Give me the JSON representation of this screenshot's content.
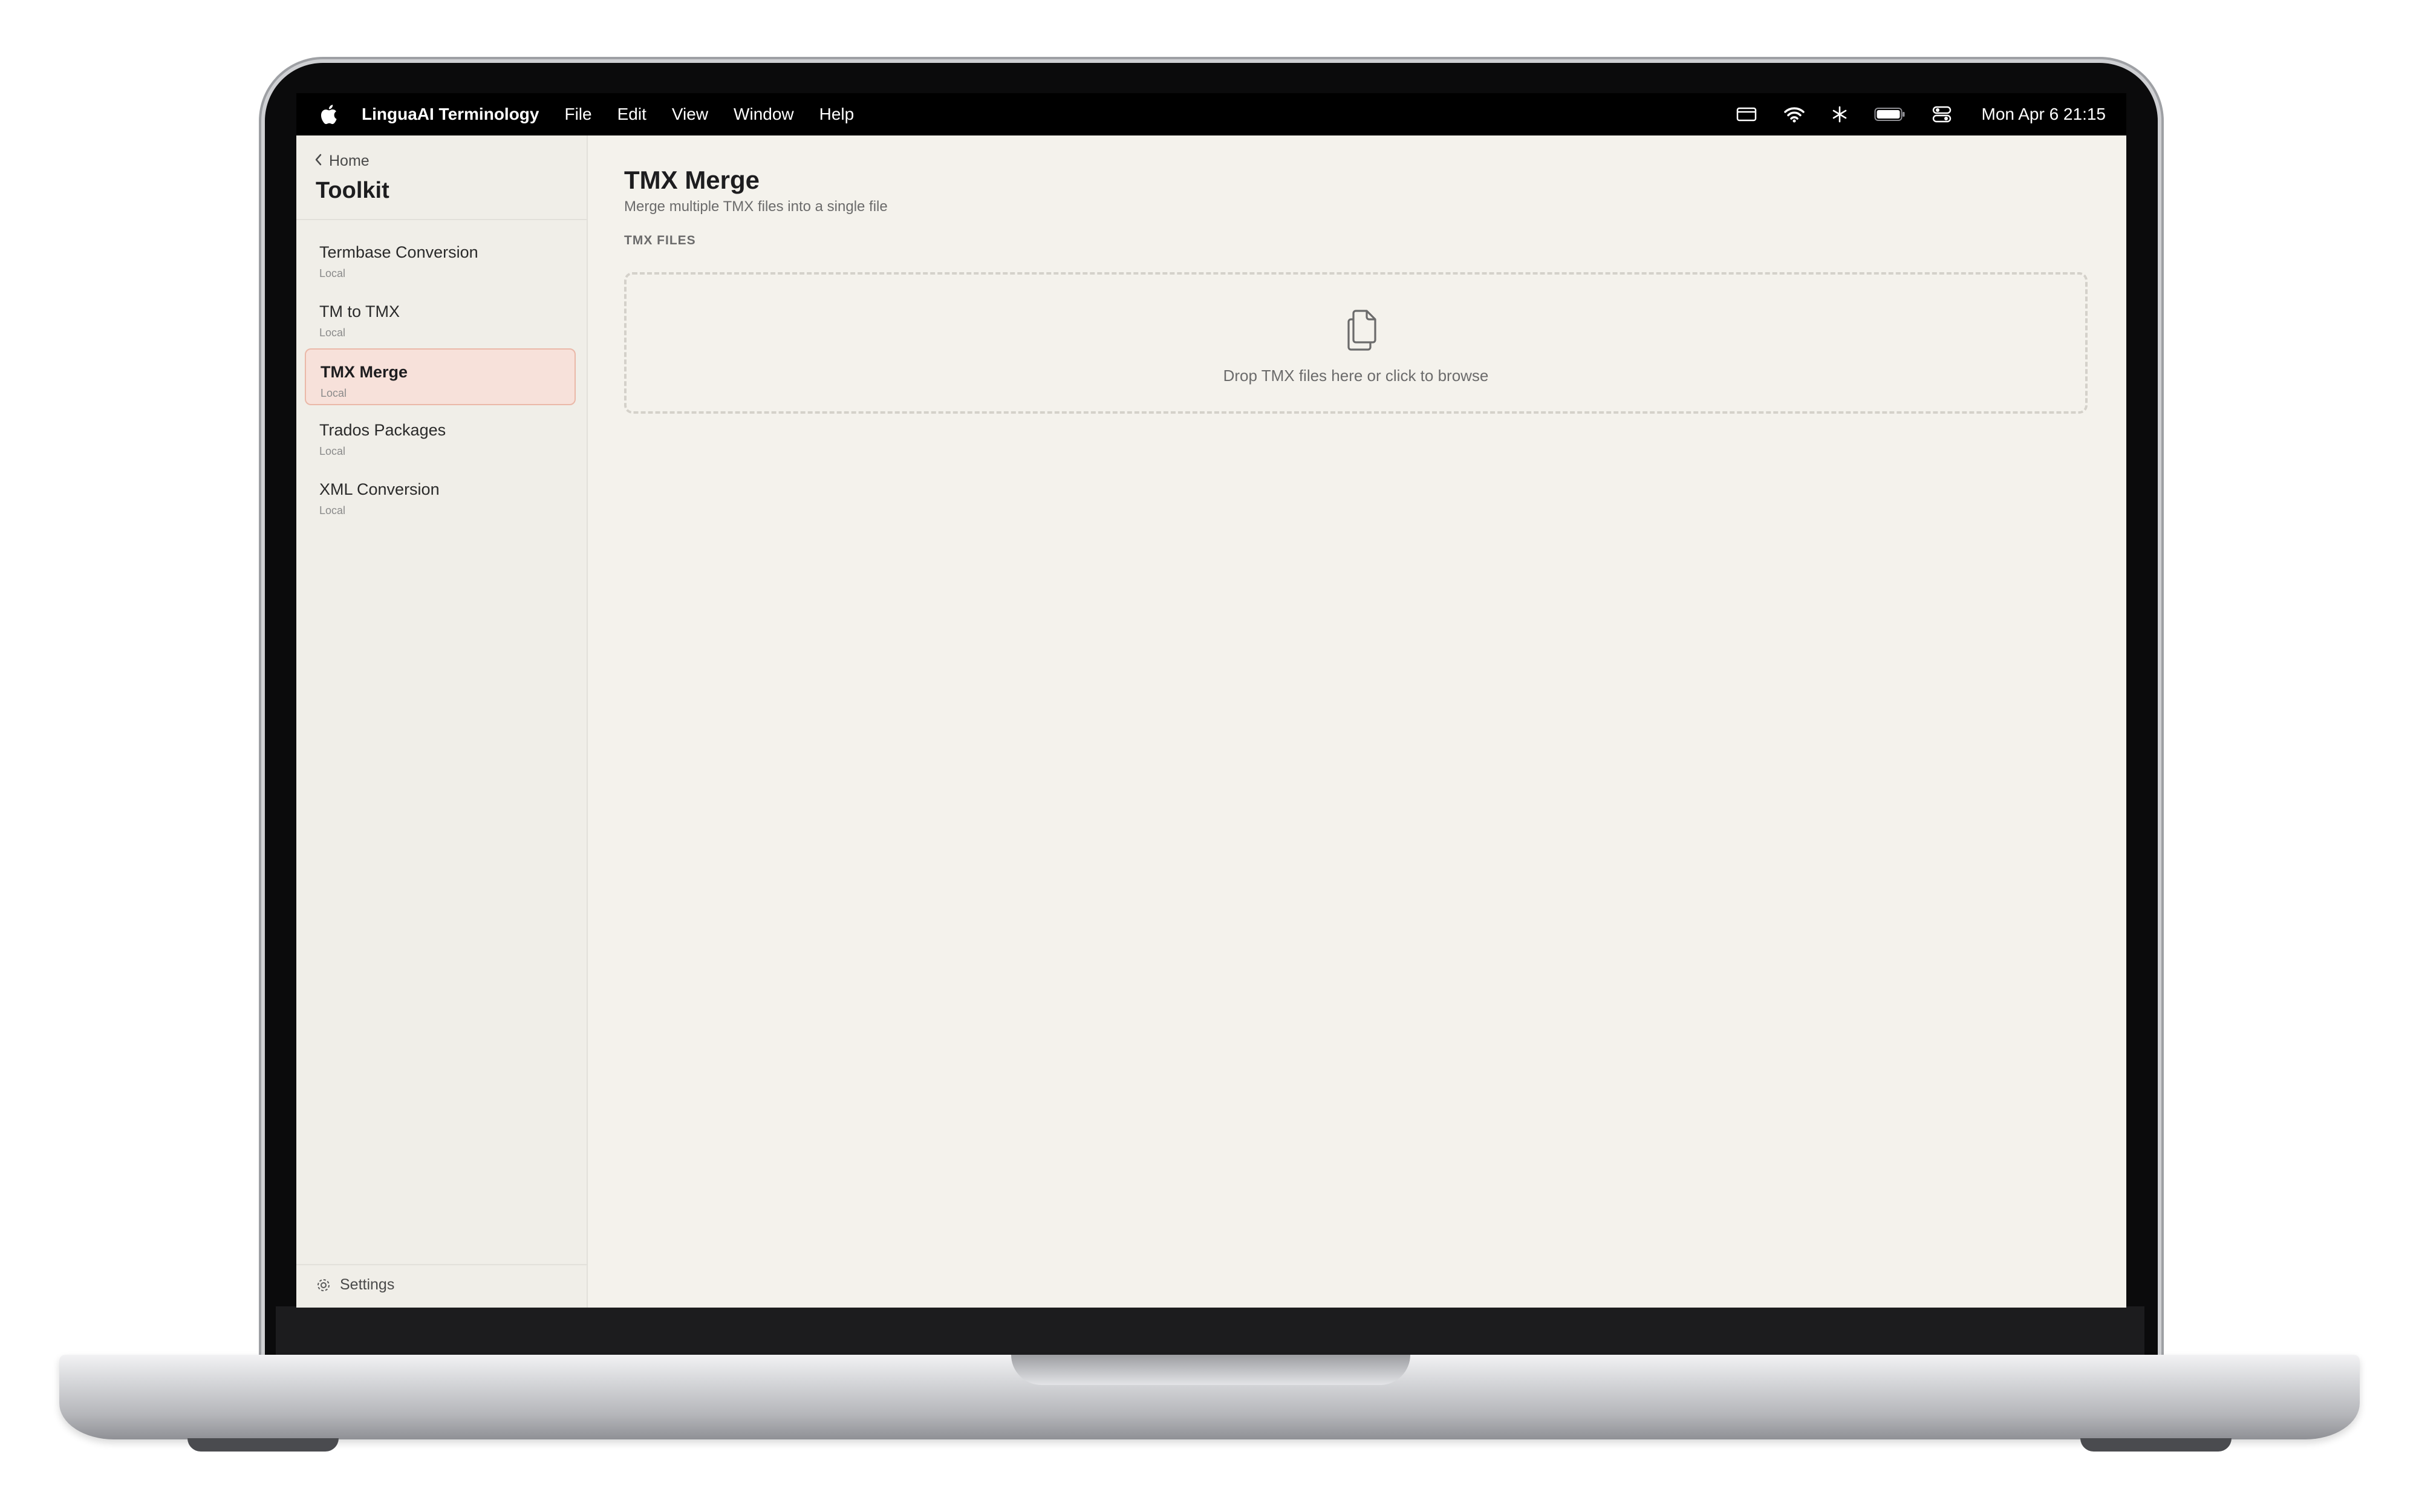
{
  "menubar": {
    "app_name": "LinguaAI Terminology",
    "menus": [
      "File",
      "Edit",
      "View",
      "Window",
      "Help"
    ],
    "clock": "Mon Apr 6  21:15",
    "status_icons": [
      "display-icon",
      "wifi-icon",
      "bluetooth-icon",
      "battery-icon",
      "control-center-icon"
    ]
  },
  "sidebar": {
    "back_label": "Home",
    "title": "Toolkit",
    "items": [
      {
        "label": "Termbase Conversion",
        "sub": "Local",
        "active": false
      },
      {
        "label": "TM to TMX",
        "sub": "Local",
        "active": false
      },
      {
        "label": "TMX Merge",
        "sub": "Local",
        "active": true
      },
      {
        "label": "Trados Packages",
        "sub": "Local",
        "active": false
      },
      {
        "label": "XML Conversion",
        "sub": "Local",
        "active": false
      }
    ],
    "settings_label": "Settings"
  },
  "main": {
    "title": "TMX Merge",
    "subtitle": "Merge multiple TMX files into a single file",
    "section_label": "TMX FILES",
    "dropzone_text": "Drop TMX files here or click to browse"
  },
  "colors": {
    "accent_bg": "#f7e1da",
    "accent_border": "#eab8a8",
    "content_bg": "#f4f2ec"
  }
}
